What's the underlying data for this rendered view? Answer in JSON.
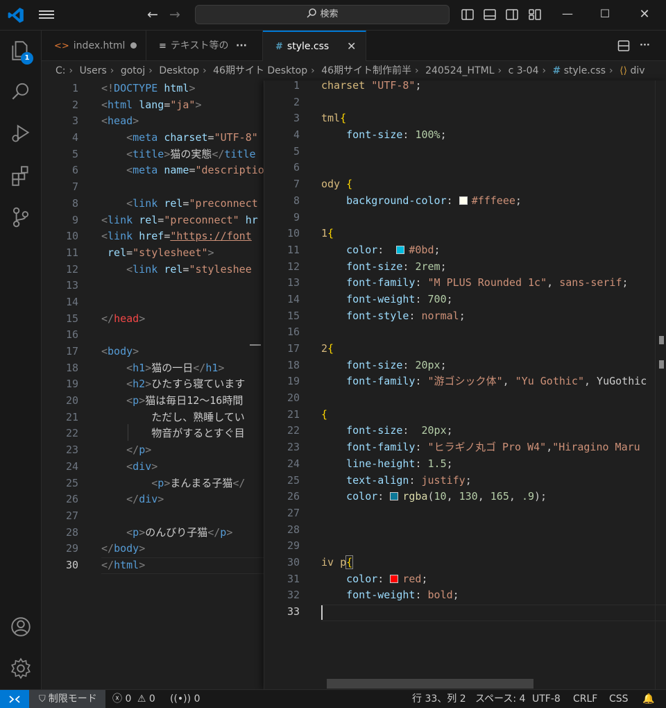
{
  "titlebar": {
    "search_label": "検索"
  },
  "activity": {
    "explorer_badge": "1"
  },
  "tabs": [
    {
      "label": "index.html",
      "icon": "<>"
    },
    {
      "label": "テキスト等の",
      "icon": "≡"
    },
    {
      "label": "style.css",
      "icon": "#"
    }
  ],
  "breadcrumb": [
    "C:",
    "Users",
    "gotoj",
    "Desktop",
    "46期サイト Desktop",
    "46期サイト制作前半",
    "240524_HTML",
    "c 3-04",
    "style.css",
    "div"
  ],
  "html_editor": {
    "line_numbers": [
      "1",
      "2",
      "3",
      "4",
      "5",
      "6",
      "7",
      "8",
      "9",
      "10",
      "11",
      "12",
      "13",
      "14",
      "15",
      "16",
      "17",
      "18",
      "19",
      "20",
      "21",
      "22",
      "23",
      "24",
      "25",
      "26",
      "27",
      "28",
      "29",
      "30"
    ]
  },
  "css_editor": {
    "line_numbers": [
      "1",
      "2",
      "3",
      "4",
      "5",
      "6",
      "7",
      "8",
      "9",
      "10",
      "11",
      "12",
      "13",
      "14",
      "15",
      "16",
      "17",
      "18",
      "19",
      "20",
      "21",
      "22",
      "23",
      "24",
      "25",
      "26",
      "27",
      "28",
      "29",
      "30",
      "31",
      "32",
      "33"
    ]
  },
  "colors": {
    "accent": "#0078d4",
    "swatch_fffeee": "#fffeee",
    "swatch_0bd": "#00bbdd",
    "swatch_rgba": "rgba(10,130,165,.9)",
    "swatch_red": "#ff0000"
  },
  "status": {
    "restricted": "制限モード",
    "errors": "0",
    "warnings": "0",
    "ports": "0",
    "position": "行 33、列 2",
    "spaces": "スペース: 4",
    "encoding": "UTF-8",
    "eol": "CRLF",
    "language": "CSS"
  }
}
